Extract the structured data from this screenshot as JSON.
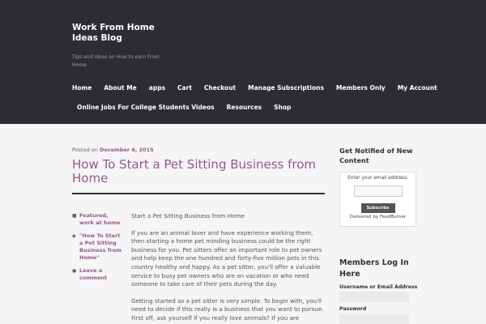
{
  "site": {
    "title": "Work From Home Ideas Blog",
    "description": "Tips and Ideas on How to earn From Home"
  },
  "nav": {
    "row1": [
      "Home",
      "About Me",
      "apps",
      "Cart",
      "Checkout",
      "Manage Subscriptions",
      "Members Only",
      "My Account"
    ],
    "row2": [
      "Online Jobs For College Students Videos",
      "Resources",
      "Shop"
    ]
  },
  "post": {
    "posted_on": "Posted on",
    "date": "December 6, 2015",
    "title": "How To Start a Pet Sitting Business from Home",
    "meta": {
      "category": "Featured, work at home",
      "tag": "\"How To Start a Pet Sitting Business from Home\"",
      "comment": "Leave a comment"
    },
    "paragraphs": [
      "Start a Pet Sitting Business from Home",
      "If you are an animal lover and have experience working them, then starting a home pet minding business could be the right business for you. Pet sitters offer an important role to pet owners and help keep the one hundred and forty-five million pets in this country healthy and happy. As a pet sitter, you'll offer a valuable service to busy pet owners who are on vacation or who need someone to take care of their pets during the day.",
      "Getting started as a pet sitter is very simple. To begin with, you'll need to decide if this really is a business that you want to pursue. First off, ask yourself if you really love animals? If you are considering pet sitting just"
    ]
  },
  "sidebar": {
    "notify_title": "Get Notified of New Content",
    "email_label": "Enter your email address:",
    "subscribe_label": "Subscribe",
    "delivered_by": "Delivered by FeedBurner",
    "members_title": "Members Log In Here",
    "username_label": "Username or Email Address",
    "password_label": "Password"
  }
}
